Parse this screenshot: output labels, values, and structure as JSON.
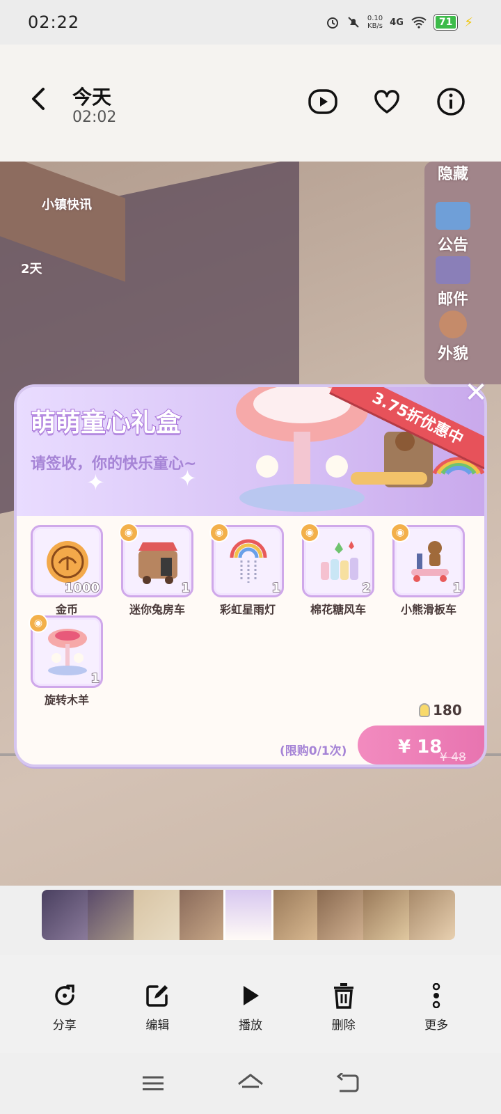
{
  "status_bar": {
    "time": "02:22",
    "net_speed_value": "0.10",
    "net_speed_unit": "KB/s",
    "signal": "4G",
    "battery": "71"
  },
  "viewer": {
    "title": "今天",
    "subtitle": "02:02"
  },
  "game": {
    "town_news": "小镇快讯",
    "days": "2天",
    "side_menu": [
      "隐藏",
      "公告",
      "邮件",
      "外貌"
    ],
    "popup": {
      "title": "萌萌童心礼盒",
      "subtitle": "请签收，你的快乐童心~",
      "discount": "3.75折优惠中",
      "close": "✕",
      "items": [
        {
          "name": "金币",
          "qty": "1000"
        },
        {
          "name": "迷你兔房车",
          "qty": "1"
        },
        {
          "name": "彩虹星雨灯",
          "qty": "1"
        },
        {
          "name": "棉花糖风车",
          "qty": "2"
        },
        {
          "name": "小熊滑板车",
          "qty": "1"
        },
        {
          "name": "旋转木羊",
          "qty": "1"
        }
      ],
      "points": "180",
      "buy_limit": "(限购0/1次)",
      "price": "¥ 18",
      "original_price": "¥ 48"
    }
  },
  "toolbar": {
    "share": "分享",
    "edit": "编辑",
    "play": "播放",
    "delete": "删除",
    "more": "更多"
  },
  "colors": {
    "accent_purple": "#a684d6",
    "price_pink": "#e874b0",
    "ribbon_red": "#e7525a"
  }
}
